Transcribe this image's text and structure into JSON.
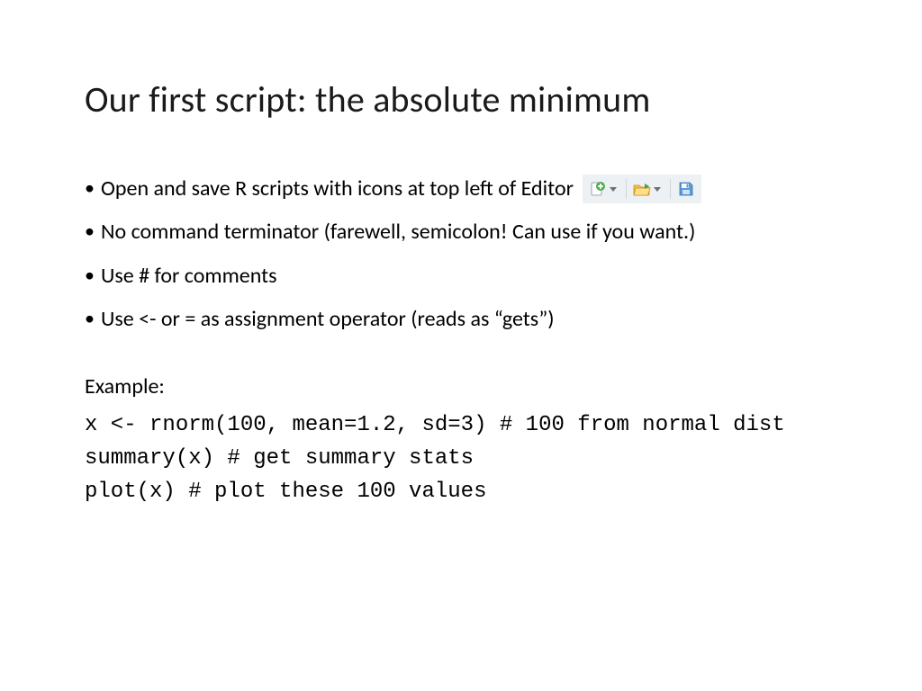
{
  "title": "Our first script: the absolute minimum",
  "bullets": [
    "Open and save R scripts with icons at top left of Editor",
    "No command terminator (farewell, semicolon! Can use if you want.)",
    "Use # for comments",
    "Use <- or = as assignment operator (reads as “gets”)"
  ],
  "example_label": "Example:",
  "code": {
    "line1": "x <- rnorm(100, mean=1.2, sd=3) # 100 from normal dist",
    "line2": "summary(x) # get summary stats",
    "line3": "plot(x) # plot these 100 values"
  },
  "icons": {
    "new": "new-file-plus-icon",
    "open": "open-folder-icon",
    "save": "save-disk-icon"
  }
}
